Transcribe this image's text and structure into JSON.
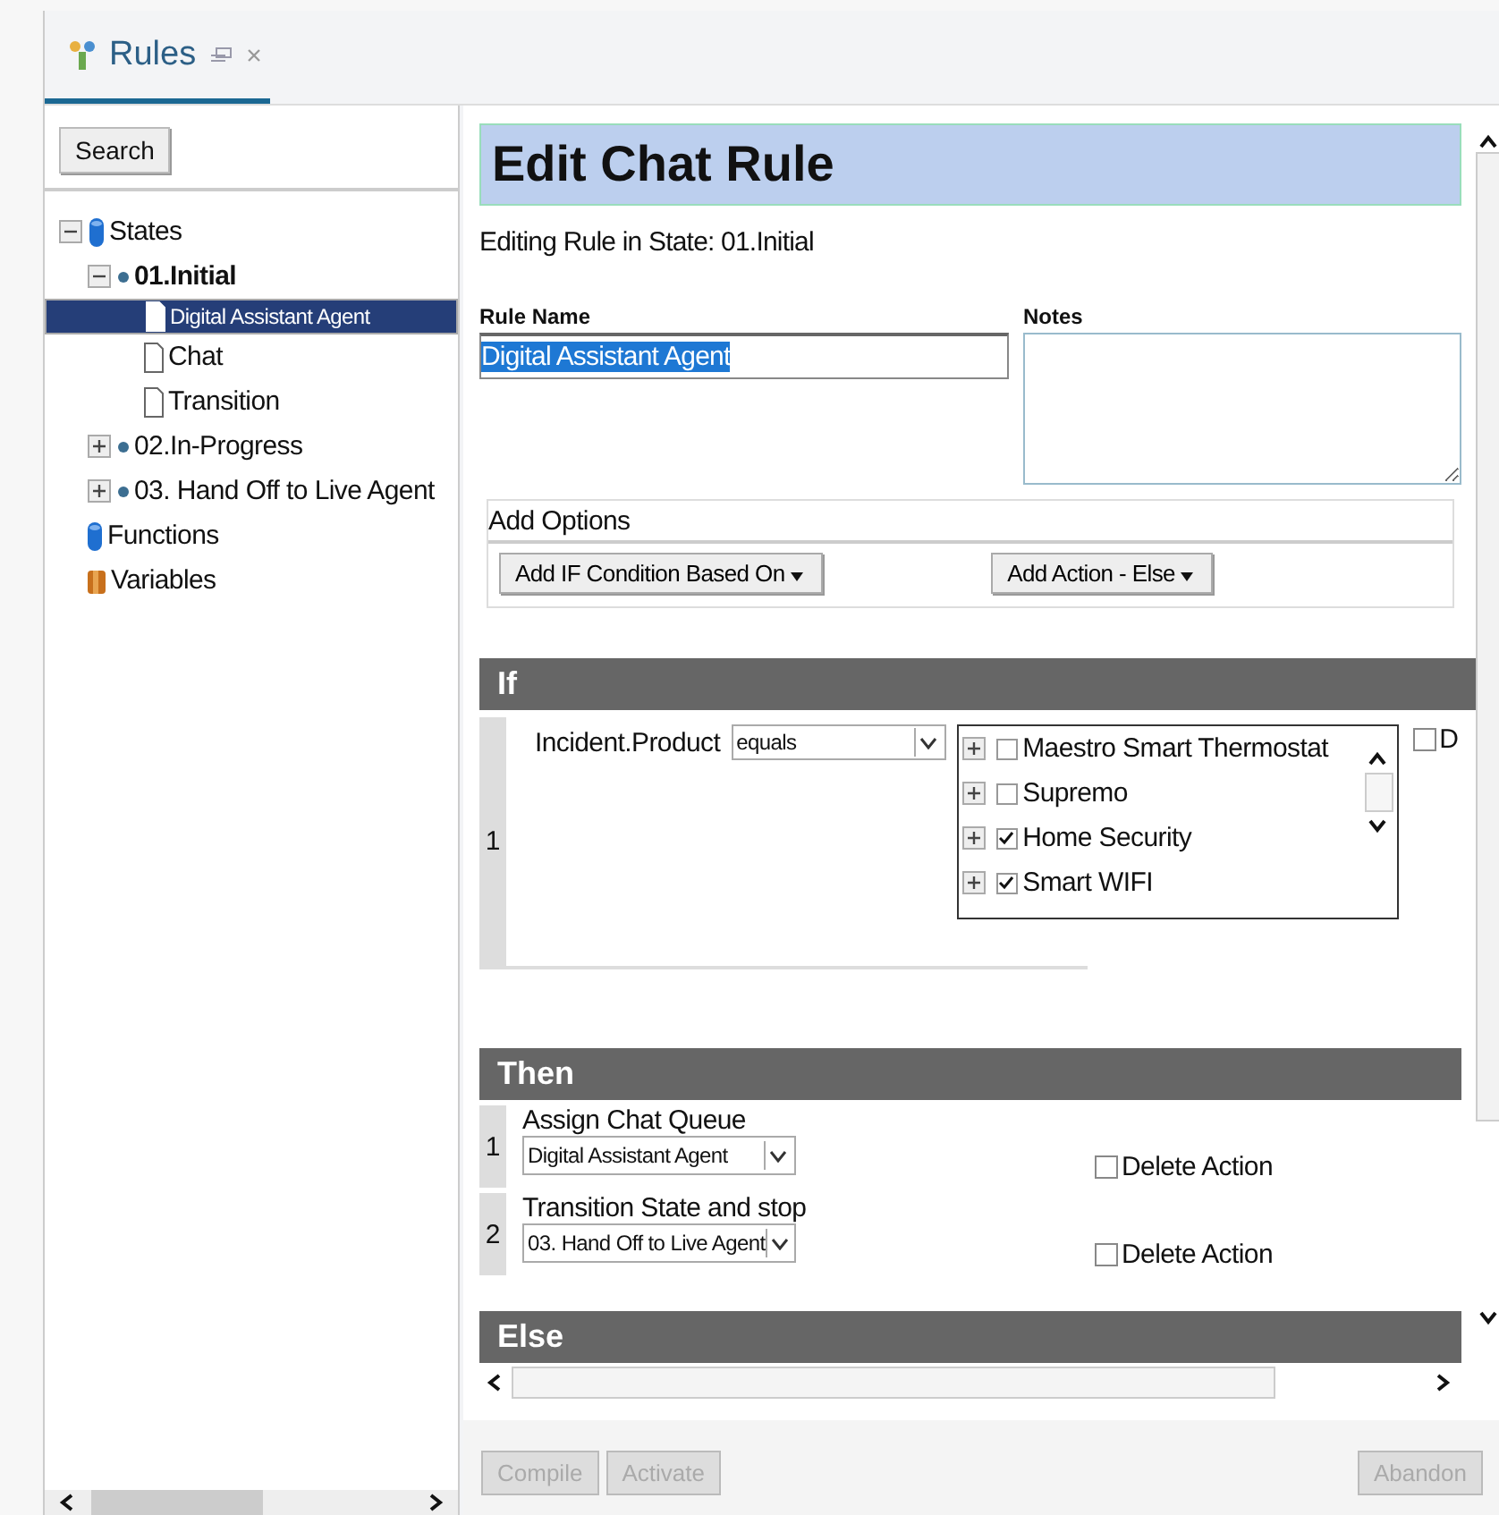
{
  "tab": {
    "label": "Rules",
    "selected": true
  },
  "sidebar": {
    "search_button": "Search",
    "tree": [
      {
        "label": "States",
        "kind": "folder",
        "expanded": true,
        "selected": false,
        "current": false,
        "children": [
          {
            "label": "01.Initial",
            "kind": "state",
            "expanded": true,
            "selected": false,
            "current": true,
            "children": [
              {
                "label": "Digital Assistant Agent",
                "kind": "rule",
                "selected": true,
                "current": false
              },
              {
                "label": "Chat",
                "kind": "rule",
                "selected": false,
                "current": false
              },
              {
                "label": "Transition",
                "kind": "rule",
                "selected": false,
                "current": false
              }
            ]
          },
          {
            "label": "02.In-Progress",
            "kind": "state",
            "expanded": false,
            "selected": false,
            "current": false
          },
          {
            "label": "03. Hand Off to Live Agent",
            "kind": "state",
            "expanded": false,
            "selected": false,
            "current": false
          }
        ]
      },
      {
        "label": "Functions",
        "kind": "folder",
        "selected": false,
        "current": false
      },
      {
        "label": "Variables",
        "kind": "package",
        "selected": false,
        "current": false
      }
    ]
  },
  "editor": {
    "title": "Edit Chat Rule",
    "subtitle": "Editing Rule in State: 01.Initial",
    "rule_name": {
      "label": "Rule Name",
      "value": "Digital Assistant Agent"
    },
    "notes": {
      "label": "Notes"
    },
    "add_options": {
      "title": "Add Options",
      "buttons": [
        "Add IF Condition Based On",
        "Add Action - Else"
      ]
    },
    "if": {
      "title": "If",
      "conditions": [
        {
          "number": "1",
          "field": "Incident.Product",
          "operator": "equals",
          "options": [
            {
              "label": "Maestro Smart Thermostat",
              "checked": false
            },
            {
              "label": "Supremo",
              "checked": false
            },
            {
              "label": "Home Security",
              "checked": true
            },
            {
              "label": "Smart WIFI",
              "checked": true
            }
          ],
          "delete_label": "D",
          "delete_checked": false
        }
      ]
    },
    "then": {
      "title": "Then",
      "actions": [
        {
          "number": "1",
          "label": "Assign Chat Queue",
          "value": "Digital Assistant Agent",
          "delete_label": "Delete Action",
          "delete_checked": false
        },
        {
          "number": "2",
          "label": "Transition State and stop",
          "value": "03. Hand Off to Live Agent",
          "delete_label": "Delete Action",
          "delete_checked": false
        }
      ]
    },
    "else": {
      "title": "Else"
    }
  },
  "footer": {
    "buttons": [
      {
        "label": "Compile",
        "disabled": true
      },
      {
        "label": "Activate",
        "disabled": true
      },
      {
        "label": "Abandon",
        "disabled": true
      }
    ]
  }
}
